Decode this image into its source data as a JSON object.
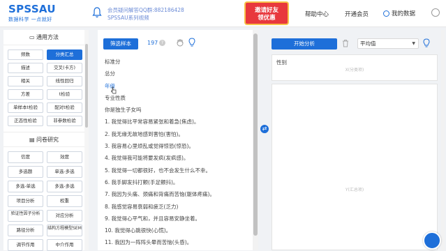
{
  "header": {
    "logo_main": "SPSSAU",
    "logo_sub": "数据科学 一点就好",
    "notice_line1": "会员疑问解答QQ群:882186428",
    "notice_line2": "SPSSAU系列视频",
    "promo_line1": "邀请好友",
    "promo_line2": "领优惠",
    "nav_help": "帮助中心",
    "nav_vip": "开通会员",
    "nav_mydata": "我的数据"
  },
  "sidebar": {
    "section1_title": "通用方法",
    "section1_items": [
      "频数",
      "分类汇总",
      "描述",
      "交叉(卡方)",
      "相关",
      "线性回归",
      "方差",
      "t检验",
      "单样本t检验",
      "配对t检验",
      "正态性检验",
      "非参数检验"
    ],
    "section1_active": "分类汇总",
    "section2_title": "问卷研究",
    "section2_items": [
      "信度",
      "效度",
      "多选题",
      "单选-多选",
      "多选-单选",
      "多选-多选",
      "项目分析",
      "权重",
      "验证性因子分析",
      "对应分析",
      "路径分析",
      "结构方程模型SEM",
      "调节作用",
      "中介作用"
    ]
  },
  "variable_panel": {
    "filter_button": "筛选样本",
    "count": "197",
    "qmark": "?",
    "variables": [
      "标准分",
      "总分",
      "年级",
      "专业性质",
      "你是独生子女吗",
      "1. 我觉得比平常容易紧张和着急(焦虑)。",
      "2. 我无缘无故地感到害怕(害怕)。",
      "3. 我容易心里烦乱或觉得惊恐(惊恐)。",
      "4. 我觉得我可能将要发疯(发疯感)。",
      "5. 我觉得一切都很好，也不会发生什么不幸。",
      "6. 我手脚发抖打颤(手足颤抖)。",
      "7. 我因为头痛、颈痛和背痛而苦恼(躯体疼痛)。",
      "8. 我感觉容易衰弱和疲乏(乏力)",
      "9. 我觉得心平气和，并且容易安静坐着。",
      "10. 我觉得心跳很快(心慌)。",
      "11. 我因为一阵阵头晕而苦恼(头昏)。"
    ],
    "highlighted": "年级"
  },
  "analysis_panel": {
    "analyze_button": "开始分析",
    "select_value": "平均值",
    "swap_icon": "⇄",
    "x_label": "性别",
    "x_placeholder": "X(分类项)",
    "y_placeholder": "Y(汇总项)"
  },
  "colors": {
    "accent": "#1e6fd9",
    "promo": "#e8383d"
  }
}
